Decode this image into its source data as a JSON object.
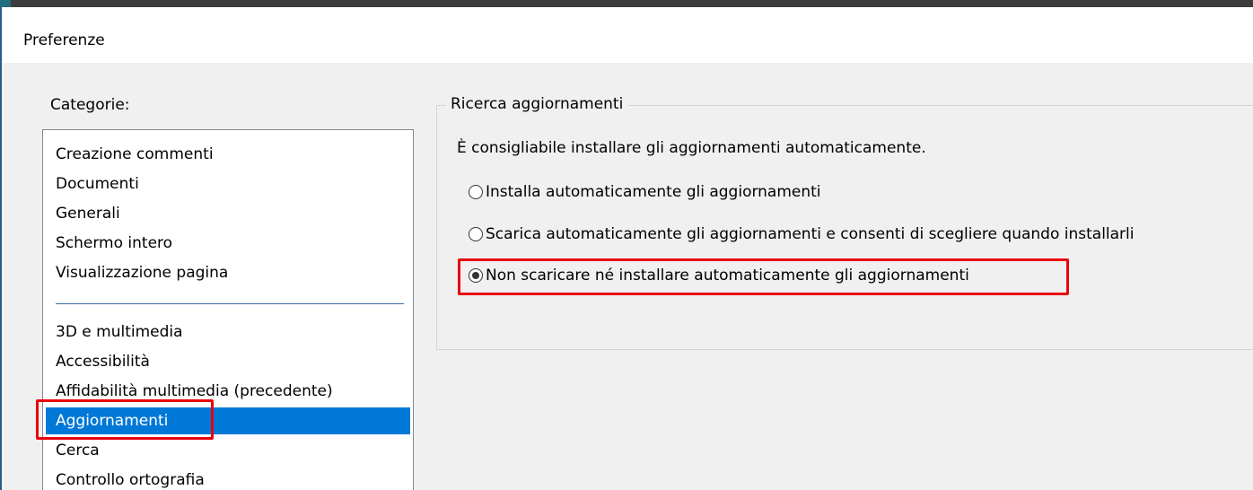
{
  "window": {
    "title": "Preferenze"
  },
  "categories": {
    "label": "Categorie:",
    "group1": [
      "Creazione commenti",
      "Documenti",
      "Generali",
      "Schermo intero",
      "Visualizzazione pagina"
    ],
    "group2": [
      "3D e multimedia",
      "Accessibilità",
      "Affidabilità multimedia (precedente)",
      "Aggiornamenti",
      "Cerca",
      "Controllo ortografia"
    ],
    "selected": "Aggiornamenti"
  },
  "updates": {
    "group_title": "Ricerca aggiornamenti",
    "info": "È consigliabile installare gli aggiornamenti automaticamente.",
    "options": [
      {
        "label": "Installa automaticamente gli aggiornamenti",
        "checked": false
      },
      {
        "label": "Scarica automaticamente gli aggiornamenti e consenti di scegliere quando installarli",
        "checked": false
      },
      {
        "label": "Non scaricare né installare automaticamente gli aggiornamenti",
        "checked": true
      }
    ]
  },
  "colors": {
    "selection": "#0078d7",
    "highlight_box": "#e8000b",
    "title_background": "#ffffff",
    "dialog_background": "#f0f0f0"
  }
}
